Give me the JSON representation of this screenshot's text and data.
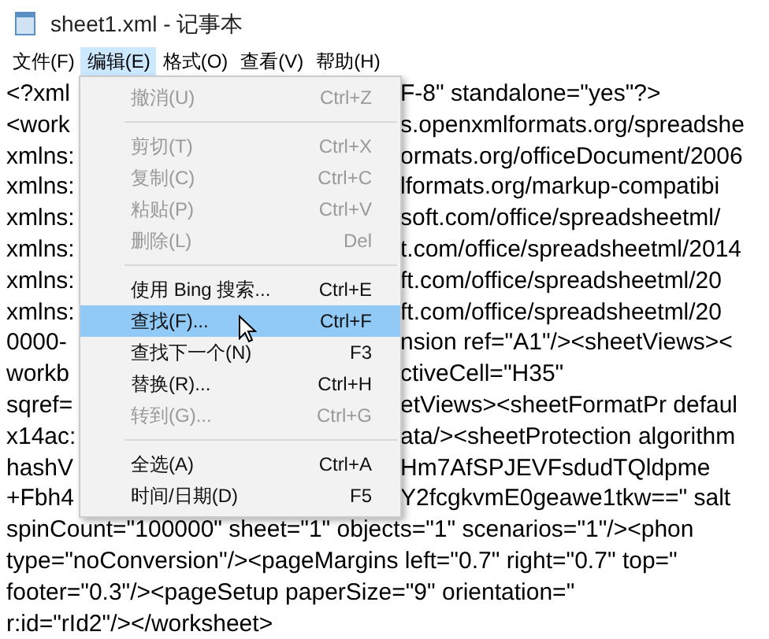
{
  "window": {
    "title": "sheet1.xml - 记事本"
  },
  "menu_bar": [
    {
      "label": "文件(F)",
      "selected": false
    },
    {
      "label": "编辑(E)",
      "selected": true
    },
    {
      "label": "格式(O)",
      "selected": false
    },
    {
      "label": "查看(V)",
      "selected": false
    },
    {
      "label": "帮助(H)",
      "selected": false
    }
  ],
  "text_lines": [
    {
      "left": "<?xml",
      "right": "F-8\" standalone=\"yes\"?>"
    },
    {
      "left": "<work",
      "right": "s.openxmlformats.org/spreadshe"
    },
    {
      "left": "xmlns:",
      "right": "ormats.org/officeDocument/2006"
    },
    {
      "left": "xmlns:",
      "right": "lformats.org/markup-compatibi"
    },
    {
      "left": "xmlns:",
      "right": "soft.com/office/spreadsheetml/"
    },
    {
      "left": "xmlns:",
      "right": "t.com/office/spreadsheetml/2014"
    },
    {
      "left": "xmlns:",
      "right": "ft.com/office/spreadsheetml/20"
    },
    {
      "left": "xmlns:",
      "right": "ft.com/office/spreadsheetml/20"
    },
    {
      "left": "0000-",
      "right": "nsion ref=\"A1\"/><sheetViews><"
    },
    {
      "left": "workb",
      "right": "ctiveCell=\"H35\""
    },
    {
      "left": "sqref=",
      "right": "etViews><sheetFormatPr defaul"
    },
    {
      "left": "x14ac:",
      "right": "ata/><sheetProtection algorithm"
    },
    {
      "left": "hashV",
      "right": "Hm7AfSPJEVFsdudTQldpme"
    },
    {
      "left": "+Fbh4",
      "right": "Y2fcgkvmE0geawe1tkw==\" salt"
    },
    {
      "left": "spinCount=\"100000\" sheet=\"1\" objects=\"1\" scenarios=\"1\"/><phon"
    },
    {
      "left": "type=\"noConversion\"/><pageMargins left=\"0.7\" right=\"0.7\" top=\""
    },
    {
      "left": "footer=\"0.3\"/><pageSetup paperSize=\"9\" orientation=\""
    },
    {
      "left": "r:id=\"rId2\"/></worksheet>"
    }
  ],
  "edit_menu": [
    {
      "kind": "item",
      "label": "撤消(U)",
      "shortcut": "Ctrl+Z",
      "disabled": true,
      "selected": false
    },
    {
      "kind": "separator"
    },
    {
      "kind": "item",
      "label": "剪切(T)",
      "shortcut": "Ctrl+X",
      "disabled": true,
      "selected": false
    },
    {
      "kind": "item",
      "label": "复制(C)",
      "shortcut": "Ctrl+C",
      "disabled": true,
      "selected": false
    },
    {
      "kind": "item",
      "label": "粘贴(P)",
      "shortcut": "Ctrl+V",
      "disabled": true,
      "selected": false
    },
    {
      "kind": "item",
      "label": "删除(L)",
      "shortcut": "Del",
      "disabled": true,
      "selected": false
    },
    {
      "kind": "separator"
    },
    {
      "kind": "item",
      "label": "使用 Bing 搜索...",
      "shortcut": "Ctrl+E",
      "disabled": false,
      "selected": false
    },
    {
      "kind": "item",
      "label": "查找(F)...",
      "shortcut": "Ctrl+F",
      "disabled": false,
      "selected": true
    },
    {
      "kind": "item",
      "label": "查找下一个(N)",
      "shortcut": "F3",
      "disabled": false,
      "selected": false
    },
    {
      "kind": "item",
      "label": "替换(R)...",
      "shortcut": "Ctrl+H",
      "disabled": false,
      "selected": false
    },
    {
      "kind": "item",
      "label": "转到(G)...",
      "shortcut": "Ctrl+G",
      "disabled": true,
      "selected": false
    },
    {
      "kind": "separator"
    },
    {
      "kind": "item",
      "label": "全选(A)",
      "shortcut": "Ctrl+A",
      "disabled": false,
      "selected": false
    },
    {
      "kind": "item",
      "label": "时间/日期(D)",
      "shortcut": "F5",
      "disabled": false,
      "selected": false
    }
  ]
}
